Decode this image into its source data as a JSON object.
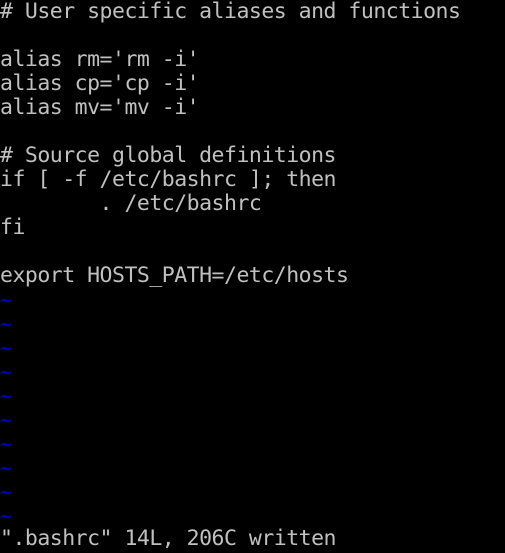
{
  "editor": {
    "lines": [
      "# User specific aliases and functions",
      "",
      "alias rm='rm -i'",
      "alias cp='cp -i'",
      "alias mv='mv -i'",
      "",
      "# Source global definitions",
      "if [ -f /etc/bashrc ]; then",
      "        . /etc/bashrc",
      "fi",
      "",
      "export HOSTS_PATH=/etc/hosts"
    ],
    "empty_line_marker": "~",
    "empty_line_count": 10
  },
  "status_line": {
    "text": "\".bashrc\" 14L, 206C written"
  },
  "colors": {
    "background": "#000000",
    "text": "#c0c0c0",
    "tilde": "#0000aa"
  }
}
